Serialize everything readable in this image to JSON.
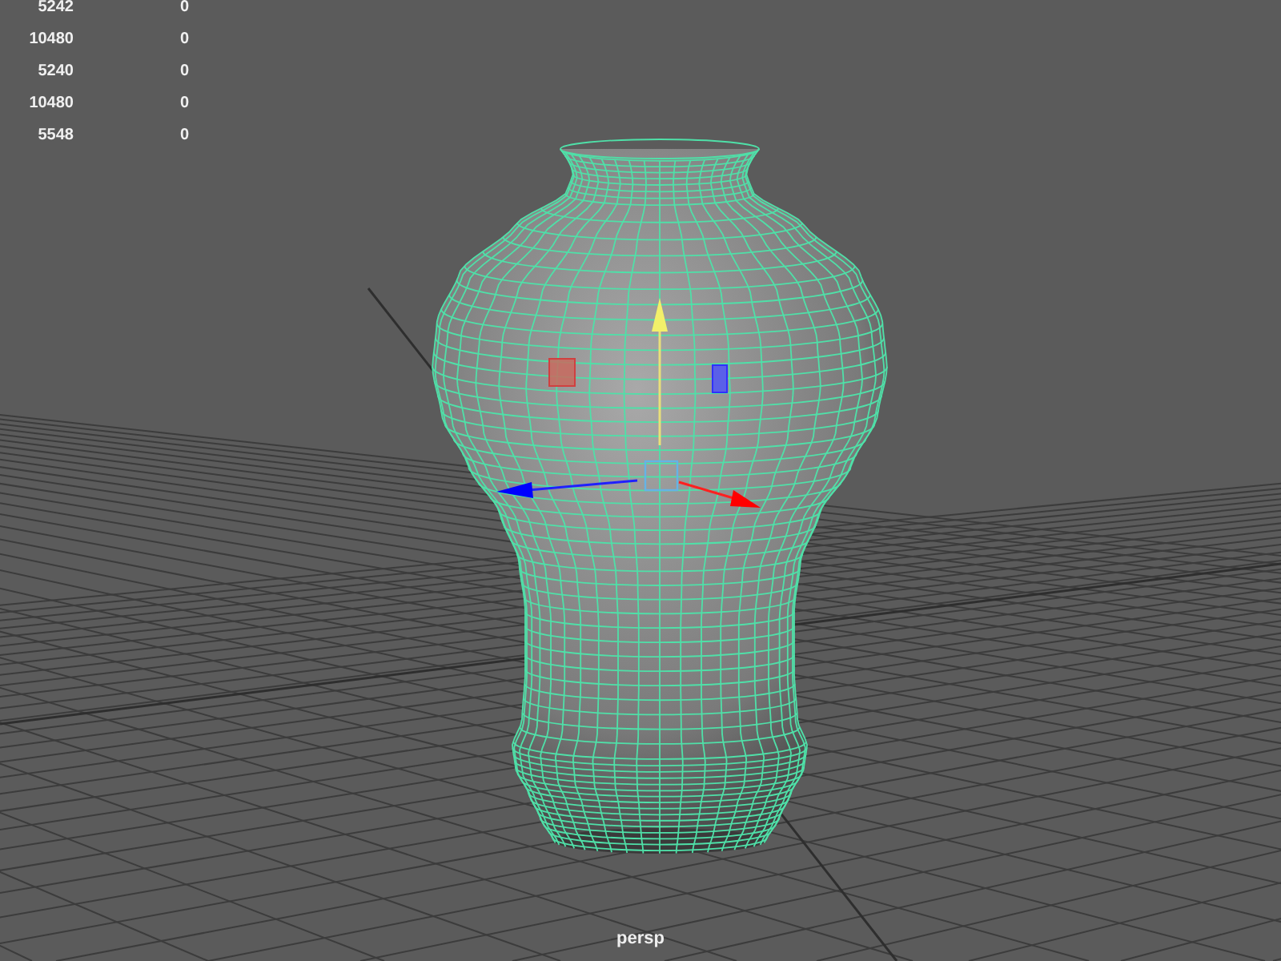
{
  "heads_up_display": {
    "rows": [
      {
        "column_1": "5242",
        "column_2": "0"
      },
      {
        "column_1": "10480",
        "column_2": "0"
      },
      {
        "column_1": "5240",
        "column_2": "0"
      },
      {
        "column_1": "10480",
        "column_2": "0"
      },
      {
        "column_1": "5548",
        "column_2": "0"
      }
    ]
  },
  "camera_label": "persp"
}
